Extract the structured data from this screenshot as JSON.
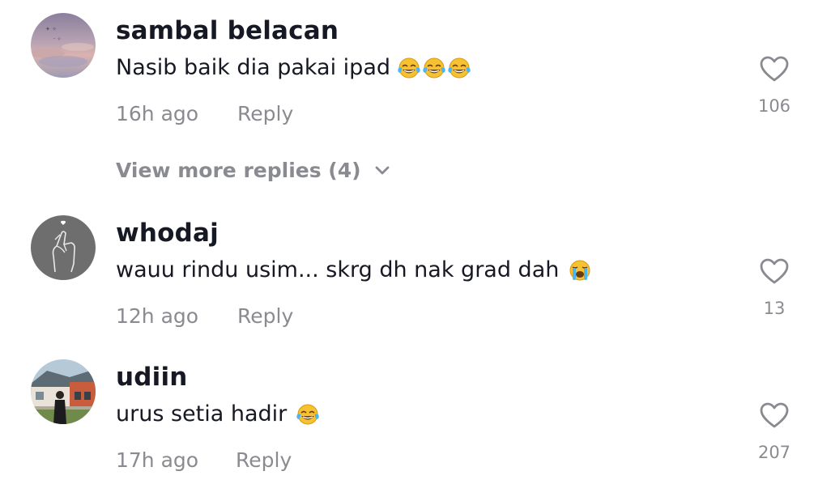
{
  "comments": [
    {
      "username": "sambal belacan",
      "text": "Nasib baik dia pakai ipad",
      "emoji": [
        "face-with-tears-of-joy",
        "face-with-tears-of-joy",
        "face-with-tears-of-joy"
      ],
      "time": "16h ago",
      "reply_label": "Reply",
      "likes": "106",
      "avatar": "avatar-sunset-sky"
    },
    {
      "username": "whodaj",
      "text": "wauu rindu usim... skrg dh nak grad dah",
      "emoji": [
        "loudly-crying-face"
      ],
      "time": "12h ago",
      "reply_label": "Reply",
      "likes": "13",
      "avatar": "avatar-finger-heart"
    },
    {
      "username": "udiin",
      "text": "urus setia hadir",
      "emoji": [
        "face-with-tears-of-joy"
      ],
      "time": "17h ago",
      "reply_label": "Reply",
      "likes": "207",
      "avatar": "avatar-person-house"
    }
  ],
  "view_more_replies": "View more replies (4)",
  "icons": {
    "like": "heart-outline-icon",
    "expand": "chevron-down-icon"
  },
  "colors": {
    "primary_text": "#161823",
    "secondary_text": "#8a8b91",
    "background": "#ffffff"
  }
}
